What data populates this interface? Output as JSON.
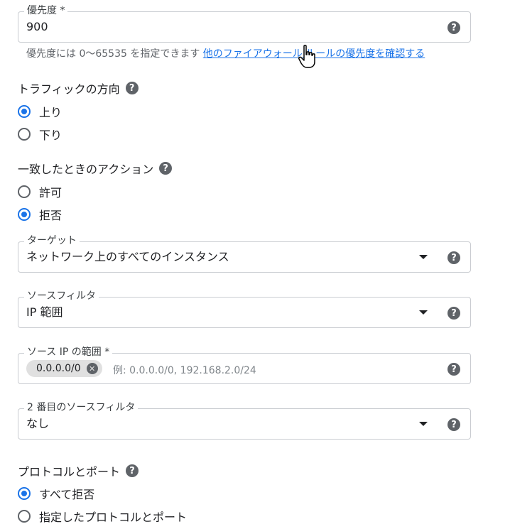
{
  "priority": {
    "label": "優先度 *",
    "value": "900",
    "hint_text": "優先度には 0〜65535 を指定できます",
    "hint_link": "他のファイアウォール ルールの優先度を確認する"
  },
  "direction": {
    "title": "トラフィックの方向",
    "options": [
      "上り",
      "下り"
    ],
    "selected": "上り"
  },
  "action": {
    "title": "一致したときのアクション",
    "options": [
      "許可",
      "拒否"
    ],
    "selected": "拒否"
  },
  "target": {
    "label": "ターゲット",
    "value": "ネットワーク上のすべてのインスタンス"
  },
  "source_filter": {
    "label": "ソースフィルタ",
    "value": "IP 範囲"
  },
  "source_ip_range": {
    "label": "ソース IP の範囲 *",
    "chip": "0.0.0.0/0",
    "placeholder": "例: 0.0.0.0/0, 192.168.2.0/24"
  },
  "second_source_filter": {
    "label": "2 番目のソースフィルタ",
    "value": "なし"
  },
  "protocols": {
    "title": "プロトコルとポート",
    "options": [
      "すべて拒否",
      "指定したプロトコルとポート"
    ],
    "selected": "すべて拒否"
  },
  "icons": {
    "help": "?",
    "chip_remove": "✕"
  },
  "colors": {
    "accent": "#1a73e8",
    "icon": "#5f6368",
    "border": "#c9ccd1"
  }
}
